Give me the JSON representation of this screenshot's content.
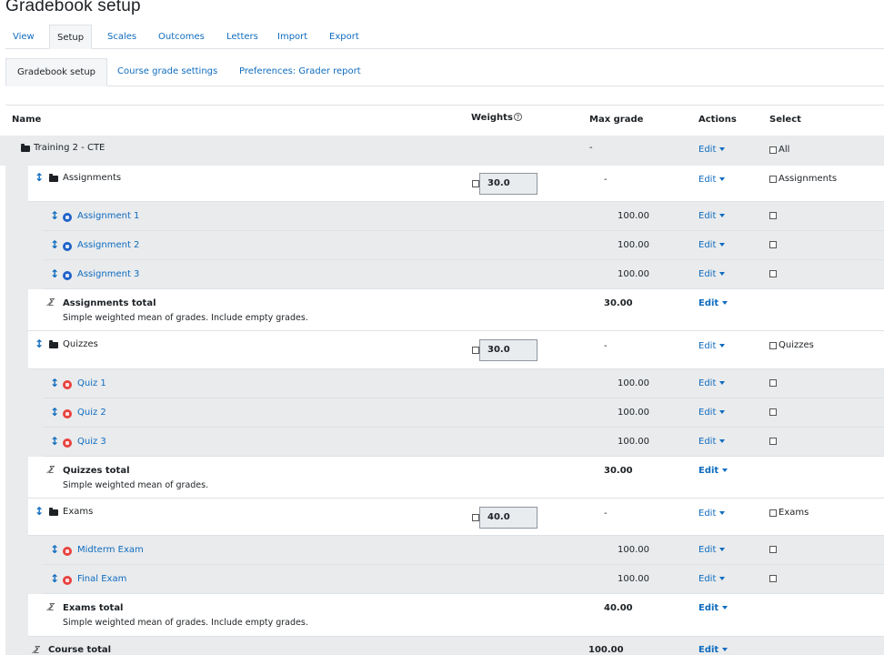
{
  "page": {
    "title": "Gradebook setup"
  },
  "nav_tabs": [
    "View",
    "Setup",
    "Scales",
    "Outcomes",
    "Letters",
    "Import",
    "Export"
  ],
  "sub_tabs": [
    "Gradebook setup",
    "Course grade settings",
    "Preferences: Grader report"
  ],
  "table": {
    "headers": {
      "name": "Name",
      "weights": "Weights",
      "max_grade": "Max grade",
      "actions": "Actions",
      "select": "Select"
    },
    "edit_label": "Edit",
    "course": {
      "name": "Training 2 - CTE",
      "max": "-",
      "select_label": "All"
    },
    "categories": [
      {
        "name": "Assignments",
        "weight": "30.0",
        "max": "-",
        "select_label": "Assignments",
        "items": [
          {
            "name": "Assignment 1",
            "max": "100.00",
            "type": "assignment"
          },
          {
            "name": "Assignment 2",
            "max": "100.00",
            "type": "assignment"
          },
          {
            "name": "Assignment 3",
            "max": "100.00",
            "type": "assignment"
          }
        ],
        "total": {
          "name": "Assignments total",
          "desc": "Simple weighted mean of grades. Include empty grades.",
          "max": "30.00"
        }
      },
      {
        "name": "Quizzes",
        "weight": "30.0",
        "max": "-",
        "select_label": "Quizzes",
        "items": [
          {
            "name": "Quiz 1",
            "max": "100.00",
            "type": "quiz"
          },
          {
            "name": "Quiz 2",
            "max": "100.00",
            "type": "quiz"
          },
          {
            "name": "Quiz 3",
            "max": "100.00",
            "type": "quiz"
          }
        ],
        "total": {
          "name": "Quizzes total",
          "desc": "Simple weighted mean of grades.",
          "max": "30.00"
        }
      },
      {
        "name": "Exams",
        "weight": "40.0",
        "max": "-",
        "select_label": "Exams",
        "items": [
          {
            "name": "Midterm Exam",
            "max": "100.00",
            "type": "quiz"
          },
          {
            "name": "Final Exam",
            "max": "100.00",
            "type": "quiz"
          }
        ],
        "total": {
          "name": "Exams total",
          "desc": "Simple weighted mean of grades. Include empty grades.",
          "max": "40.00"
        }
      }
    ],
    "course_total": {
      "name": "Course total",
      "max": "100.00"
    }
  },
  "icons": {
    "move": "move-arrows-icon",
    "folder": "folder-icon",
    "assignment": "assignment-icon",
    "quiz": "quiz-icon",
    "sigma": "calculation-sigma-icon",
    "help": "help-circle-icon",
    "caret": "caret-down-icon"
  },
  "colors": {
    "link": "#0f6cbf",
    "row_shade": "#e9ebed",
    "assignment_icon": "#1f62c9",
    "quiz_icon": "#e8423f"
  }
}
